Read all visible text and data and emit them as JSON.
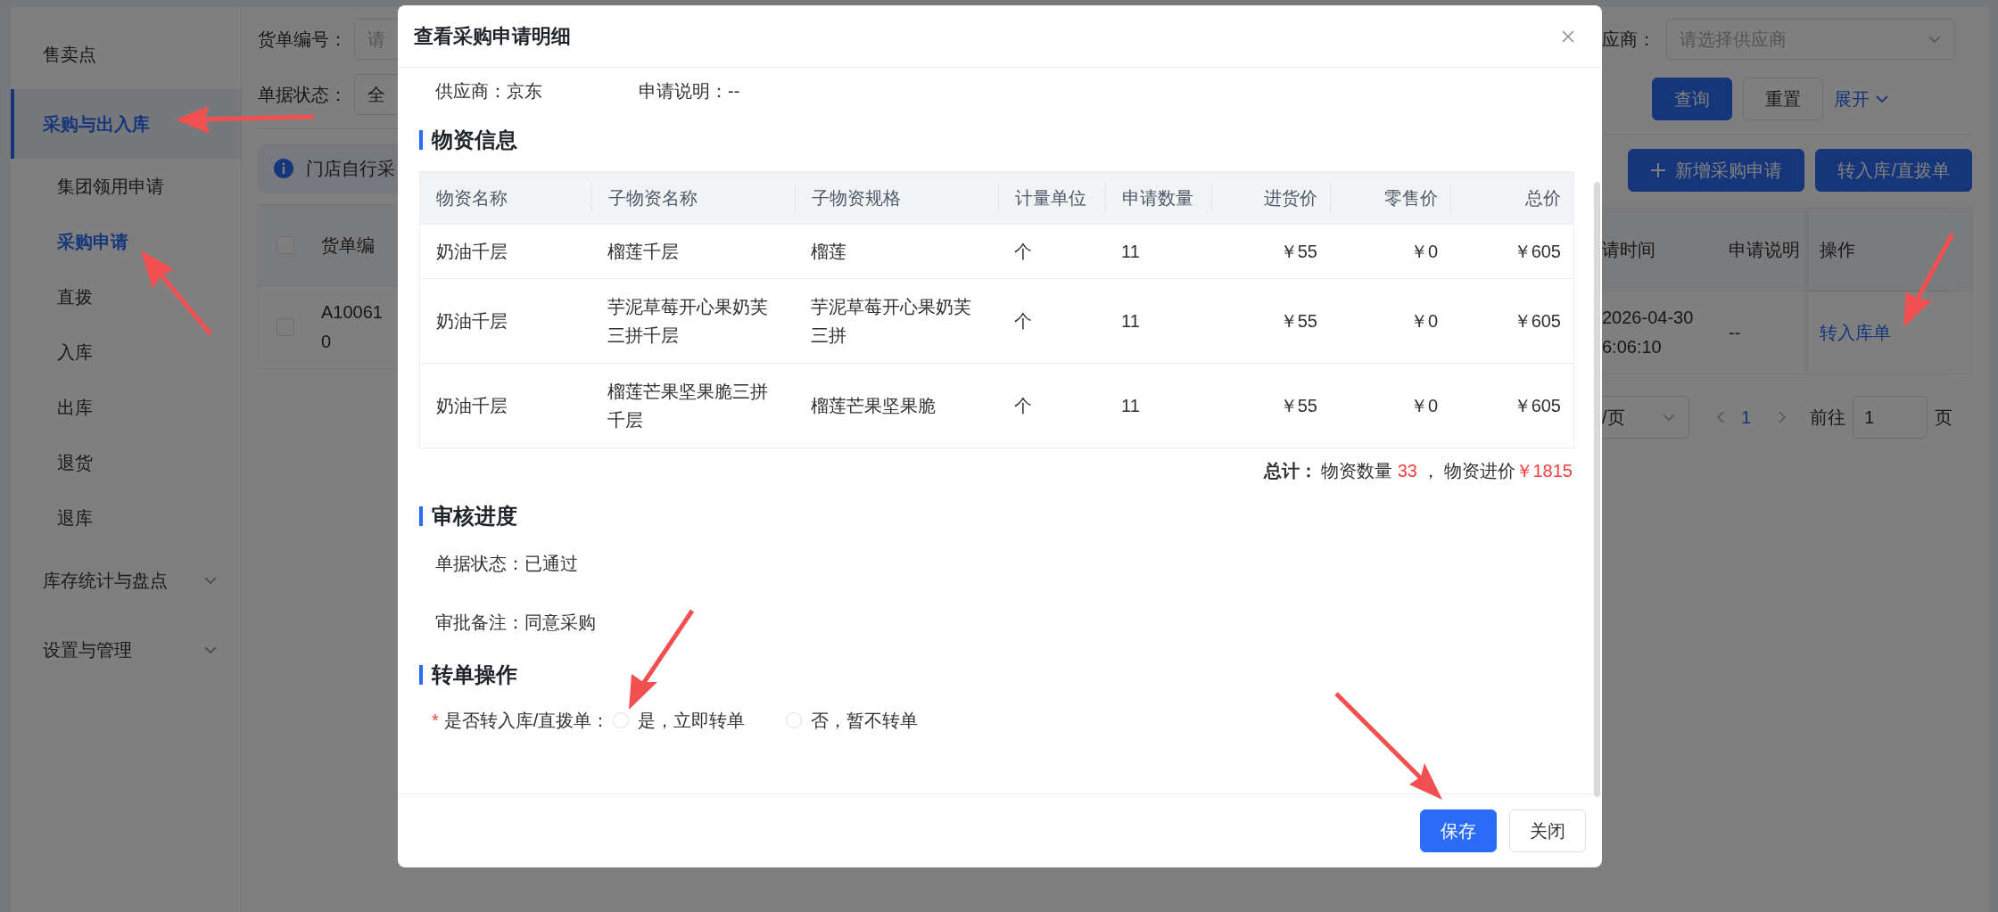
{
  "sidebar": {
    "items": [
      {
        "label": "售卖点",
        "selected": false,
        "kind": "link"
      },
      {
        "label": "采购与出入库",
        "selected": true,
        "kind": "section",
        "children": [
          {
            "label": "集团领用申请",
            "selected": false
          },
          {
            "label": "采购申请",
            "selected": true
          },
          {
            "label": "直拨",
            "selected": false
          },
          {
            "label": "入库",
            "selected": false
          },
          {
            "label": "出库",
            "selected": false
          },
          {
            "label": "退货",
            "selected": false
          },
          {
            "label": "退库",
            "selected": false
          }
        ]
      },
      {
        "label": "库存统计与盘点",
        "selected": false,
        "kind": "group"
      },
      {
        "label": "设置与管理",
        "selected": false,
        "kind": "group"
      }
    ]
  },
  "filters_left": [
    {
      "label": "货单编号：",
      "placeholder": "请"
    },
    {
      "label": "单据状态：",
      "value": "全"
    }
  ],
  "filter_right": {
    "label": "应商：",
    "placeholder": "请选择供应商"
  },
  "filter_buttons": [
    {
      "label": "查询",
      "kind": "primary"
    },
    {
      "label": "重置",
      "kind": "default"
    }
  ],
  "expand_link": "展开",
  "notice": "门店自行采",
  "toolbar_buttons": [
    {
      "label": "新增采购申请"
    },
    {
      "label": "转入库/直拨单"
    }
  ],
  "list_table": {
    "header_checked": false,
    "left_column": "货单编",
    "right_columns": [
      "请时间",
      "申请说明",
      "操作"
    ],
    "rows": [
      {
        "checked": false,
        "id_lines": [
          "A10061",
          "0"
        ],
        "time_lines": [
          "2026-04-30",
          "6:06:10"
        ],
        "note": "--",
        "action": "转入库单"
      }
    ]
  },
  "pagination": {
    "page_size": "/页",
    "pages": [
      {
        "label": "1",
        "selected": true
      }
    ],
    "goto_label": "前往",
    "goto_value": "1",
    "page_suffix": "页"
  },
  "dialog": {
    "title": "查看采购申请明细",
    "info_fields": [
      {
        "label": "供应商：",
        "value": "京东"
      },
      {
        "label": "申请说明：",
        "value": "--"
      }
    ],
    "materials": {
      "title": "物资信息",
      "columns": [
        "物资名称",
        "子物资名称",
        "子物资规格",
        "计量单位",
        "申请数量",
        "进货价",
        "零售价",
        "总价"
      ],
      "rows": [
        [
          "奶油千层",
          "榴莲千层",
          "榴莲",
          "个",
          "11",
          "￥55",
          "￥0",
          "￥605"
        ],
        [
          "奶油千层",
          "芋泥草莓开心果奶芙三拼千层",
          "芋泥草莓开心果奶芙三拼",
          "个",
          "11",
          "￥55",
          "￥0",
          "￥605"
        ],
        [
          "奶油千层",
          "榴莲芒果坚果脆三拼千层",
          "榴莲芒果坚果脆",
          "个",
          "11",
          "￥55",
          "￥0",
          "￥605"
        ]
      ],
      "total": {
        "label": "总计：",
        "qty_label": "物资数量",
        "qty": "33",
        "sep": "，",
        "price_label": "物资进价",
        "price": "￥1815"
      }
    },
    "review": {
      "title": "审核进度",
      "fields": [
        {
          "label": "单据状态：",
          "value": "已通过"
        },
        {
          "label": "审批备注：",
          "value": "同意采购"
        }
      ]
    },
    "transfer": {
      "title": "转单操作",
      "required_mark": "*",
      "label": "是否转入库/直拨单：",
      "options": [
        {
          "label": "是，立即转单",
          "selected": false
        },
        {
          "label": "否，暂不转单",
          "selected": false
        }
      ]
    },
    "buttons": [
      {
        "label": "保存",
        "kind": "primary"
      },
      {
        "label": "关闭",
        "kind": "default"
      }
    ]
  }
}
